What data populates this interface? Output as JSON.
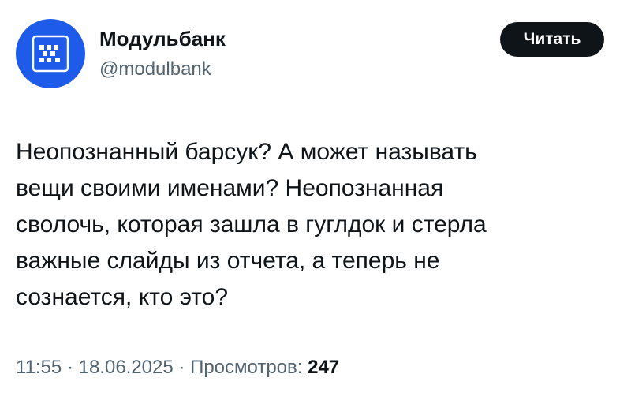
{
  "author": {
    "name": "Модульбанк",
    "handle": "@modulbank",
    "avatar_color": "#1f5bea",
    "avatar_icon": "modulbank-logo-icon"
  },
  "follow_button": {
    "label": "Читать"
  },
  "tweet": {
    "lines": [
      "Неопознанный барсук? А может называть",
      "вещи своими именами? Неопознанная",
      "сволочь, которая зашла в гуглдок и стерла",
      "важные слайды из отчета, а теперь не",
      "сознается, кто это?"
    ]
  },
  "meta": {
    "time": "11:55",
    "date": "18.06.2025",
    "views_label": "Просмотров:",
    "views_count": "247",
    "separator": " · "
  }
}
